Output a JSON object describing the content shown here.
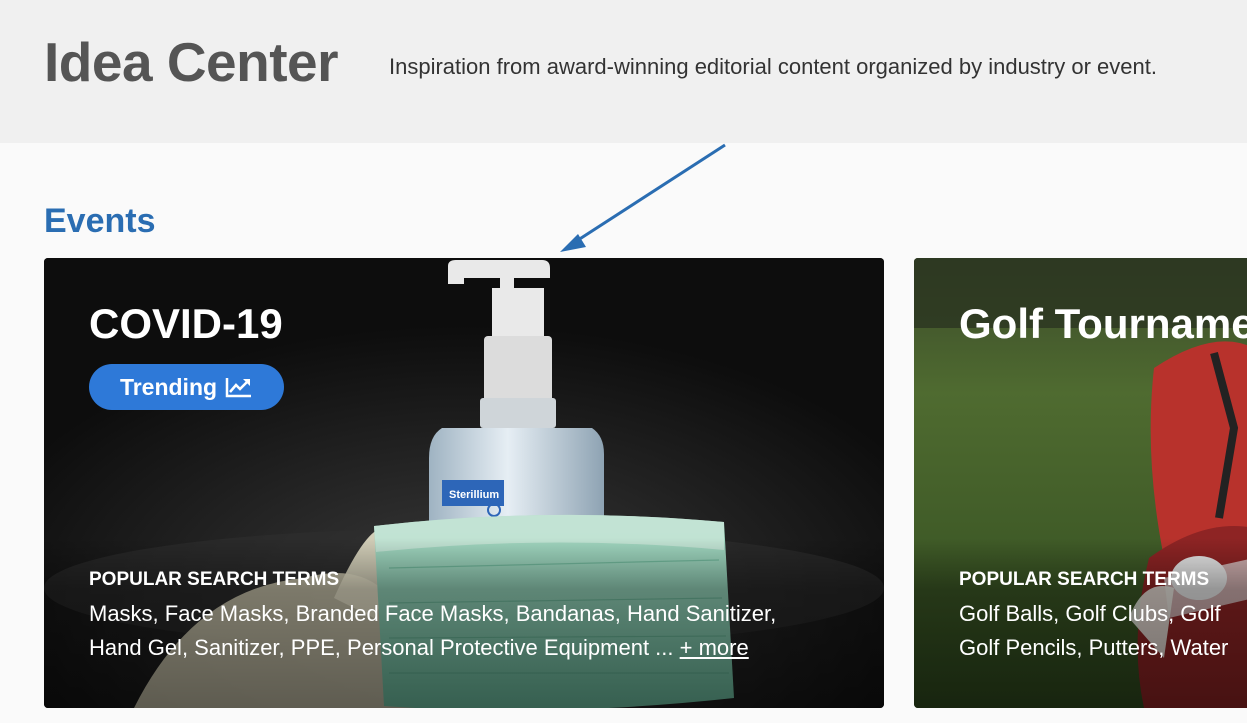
{
  "header": {
    "title": "Idea Center",
    "subtitle": "Inspiration from award-winning editorial content organized by industry or event."
  },
  "section": {
    "title": "Events"
  },
  "cards": [
    {
      "title": "COVID-19",
      "badge": "Trending",
      "terms_label": "POPULAR SEARCH TERMS",
      "terms_line1": "Masks, Face Masks, Branded Face Masks, Bandanas, Hand Sanitizer,",
      "terms_line2": "Hand Gel, Sanitizer, PPE, Personal Protective Equipment ...",
      "more_link": "+ more",
      "bottle_label": "Sterillium"
    },
    {
      "title": "Golf Tourname",
      "terms_label": "POPULAR SEARCH TERMS",
      "terms_line1": "Golf Balls, Golf Clubs, Golf",
      "terms_line2": "Golf Pencils, Putters, Water"
    }
  ],
  "colors": {
    "header_bg": "#f0f0f0",
    "title_gray": "#555555",
    "section_blue": "#2a6db2",
    "badge_blue": "#2e79d8",
    "arrow_blue": "#2a6db2"
  }
}
